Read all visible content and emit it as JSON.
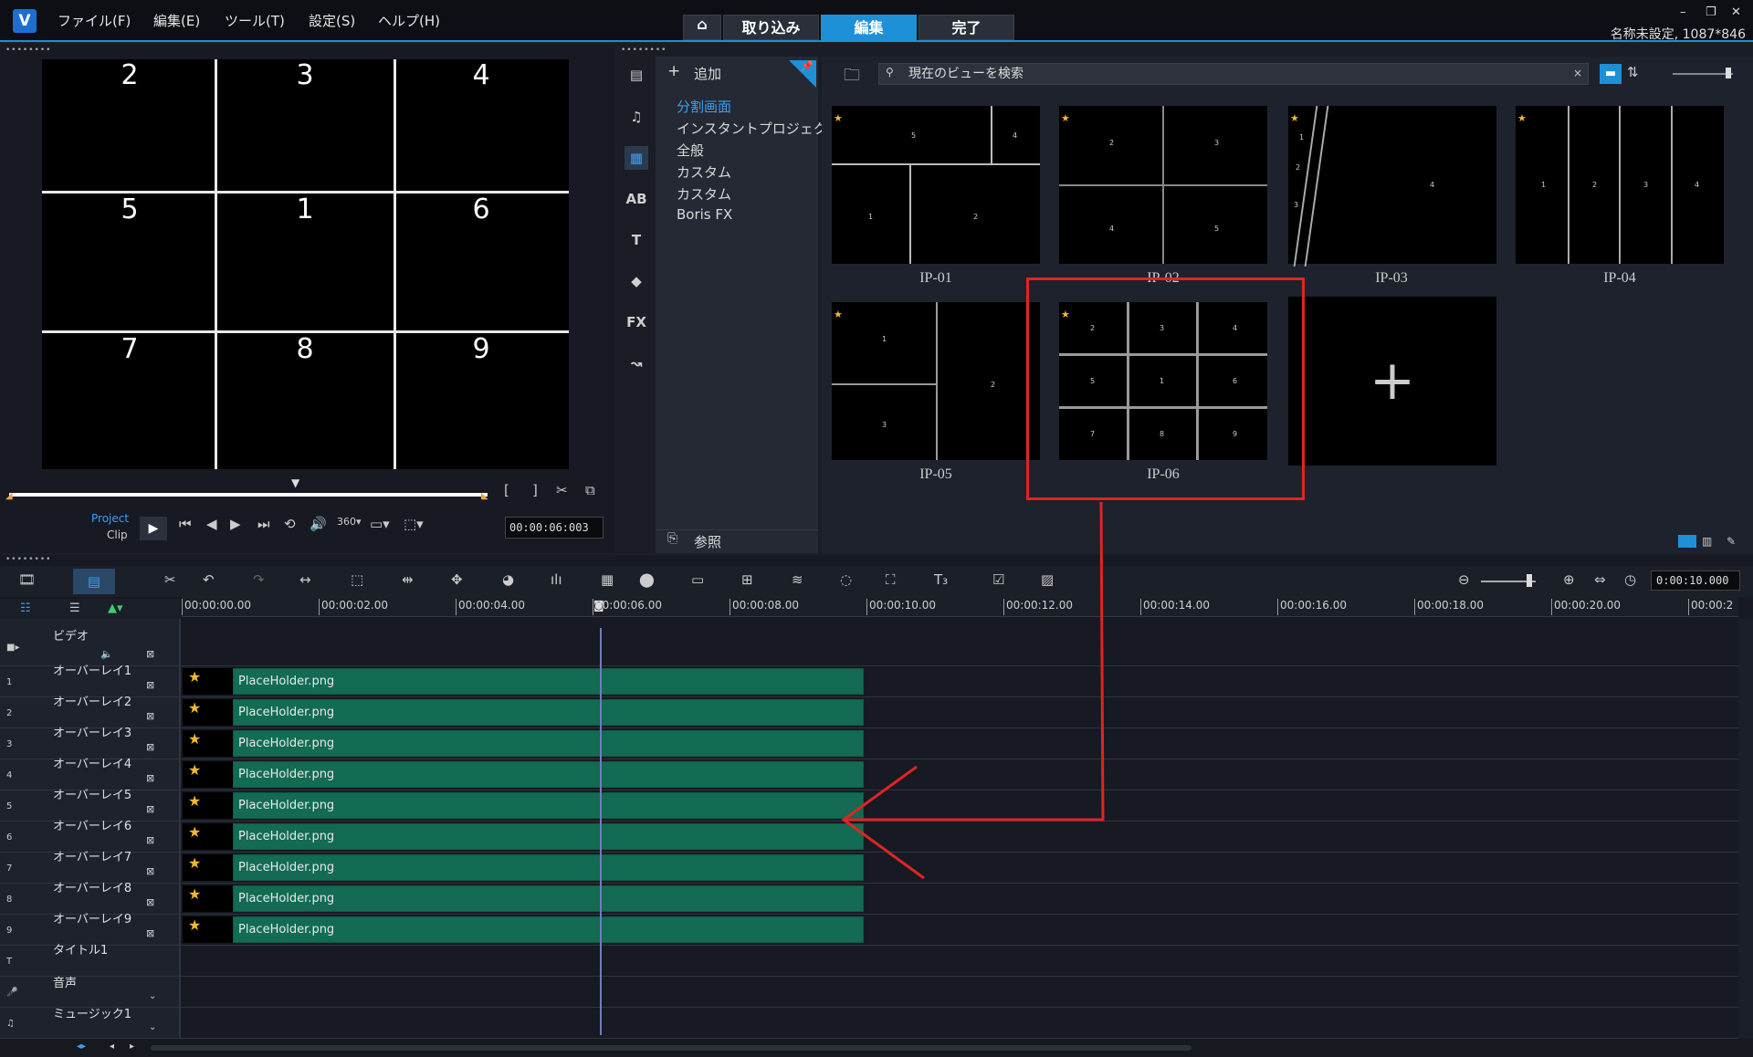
{
  "menu": {
    "logo": "V",
    "items": [
      "ファイル(F)",
      "編集(E)",
      "ツール(T)",
      "設定(S)",
      "ヘルプ(H)"
    ]
  },
  "mode_tabs": {
    "home_icon": "home-icon",
    "capture": "取り込み",
    "edit": "編集",
    "finish": "完了",
    "active": "編集"
  },
  "project_info": "名称未設定, 1087*846",
  "window_controls": [
    "–",
    "❐",
    "✕"
  ],
  "preview": {
    "cells": [
      "2",
      "3",
      "4",
      "5",
      "1",
      "6",
      "7",
      "8",
      "9"
    ]
  },
  "player": {
    "project_label": "Project",
    "clip_label": "Clip",
    "timecode": "00:00:06:003",
    "mark_in": "[",
    "mark_out": "]",
    "playhead_position": 0.47
  },
  "library": {
    "add_label": "追加",
    "categories": [
      "分割画面",
      "インスタントプロジェクト",
      "全般",
      "カスタム",
      "カスタム",
      "Boris FX"
    ],
    "selected_category": "分割画面",
    "browse_label": "参照",
    "search_placeholder": "現在のビューを検索",
    "search_clear": "×",
    "sidebar_icons": [
      "media-icon",
      "audio-icon",
      "instant-project-icon",
      "transition-icon",
      "title-icon",
      "graphics-icon",
      "fx-icon",
      "motion-path-icon"
    ],
    "fx_glyph": "FX",
    "templates": [
      {
        "label": "IP-01",
        "digits": [
          "5",
          "4",
          "1",
          "2"
        ]
      },
      {
        "label": "IP-02",
        "digits": [
          "2",
          "3",
          "4",
          "5"
        ]
      },
      {
        "label": "IP-03",
        "digits": [
          "1",
          "2",
          "3",
          "4"
        ]
      },
      {
        "label": "IP-04",
        "digits": [
          "1",
          "2",
          "3",
          "4"
        ]
      },
      {
        "label": "IP-05",
        "digits": [
          "1",
          "2",
          "3"
        ]
      },
      {
        "label": "IP-06",
        "digits": [
          "2",
          "3",
          "4",
          "5",
          "1",
          "6",
          "7",
          "8",
          "9"
        ]
      }
    ],
    "add_template_glyph": "+",
    "highlighted_template": "IP-06",
    "accent_color": "#1e90d8"
  },
  "timeline": {
    "ruler": [
      "00:00:00.00",
      "00:00:02.00",
      "00:00:04.00",
      "00:00:06.00",
      "00:00:08.00",
      "00:00:10.00",
      "00:00:12.00",
      "00:00:14.00",
      "00:00:16.00",
      "00:00:18.00",
      "00:00:20.00",
      "00:00:2"
    ],
    "zoom_time": "0:00:10.000",
    "tracks": [
      {
        "name": "ビデオ",
        "num": "",
        "clip": null
      },
      {
        "name": "オーバーレイ1",
        "num": "1",
        "clip": "PlaceHolder.png"
      },
      {
        "name": "オーバーレイ2",
        "num": "2",
        "clip": "PlaceHolder.png"
      },
      {
        "name": "オーバーレイ3",
        "num": "3",
        "clip": "PlaceHolder.png"
      },
      {
        "name": "オーバーレイ4",
        "num": "4",
        "clip": "PlaceHolder.png"
      },
      {
        "name": "オーバーレイ5",
        "num": "5",
        "clip": "PlaceHolder.png"
      },
      {
        "name": "オーバーレイ6",
        "num": "6",
        "clip": "PlaceHolder.png"
      },
      {
        "name": "オーバーレイ7",
        "num": "7",
        "clip": "PlaceHolder.png"
      },
      {
        "name": "オーバーレイ8",
        "num": "8",
        "clip": "PlaceHolder.png"
      },
      {
        "name": "オーバーレイ9",
        "num": "9",
        "clip": "PlaceHolder.png"
      },
      {
        "name": "タイトル1",
        "num": "T",
        "clip": null
      },
      {
        "name": "音声",
        "num": "",
        "clip": null
      },
      {
        "name": "ミュージック1",
        "num": "",
        "clip": null
      }
    ],
    "clip_color": "#126b52",
    "annotation_color": "#e02424"
  }
}
